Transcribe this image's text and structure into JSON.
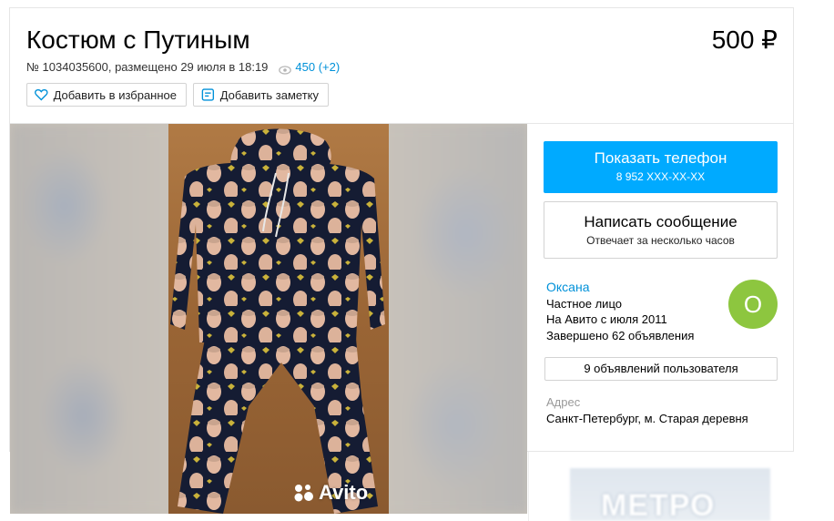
{
  "listing": {
    "title": "Костюм с Путиным",
    "price": "500 ₽",
    "meta": "№ 1034035600, размещено 29 июля в 18:19",
    "views": "450 (+2)"
  },
  "actions": {
    "favorite_label": "Добавить в избранное",
    "note_label": "Добавить заметку"
  },
  "contact": {
    "show_phone_label": "Показать телефон",
    "phone_masked": "8 952 XXX-XX-XX",
    "write_message_label": "Написать сообщение",
    "response_time": "Отвечает за несколько часов"
  },
  "seller": {
    "name": "Оксана",
    "type": "Частное лицо",
    "since": "На Авито с июля 2011",
    "completed": "Завершено 62 объявления",
    "avatar_letter": "О",
    "avatar_color": "#8dc63f",
    "ads_link": "9 объявлений пользователя"
  },
  "address": {
    "label": "Адрес",
    "value": "Санкт-Петербург, м. Старая деревня"
  },
  "gallery": {
    "watermark": "Avito"
  },
  "ad": {
    "text": "МЕТРО"
  },
  "colors": {
    "accent": "#00aaff",
    "link": "#0091d9"
  }
}
